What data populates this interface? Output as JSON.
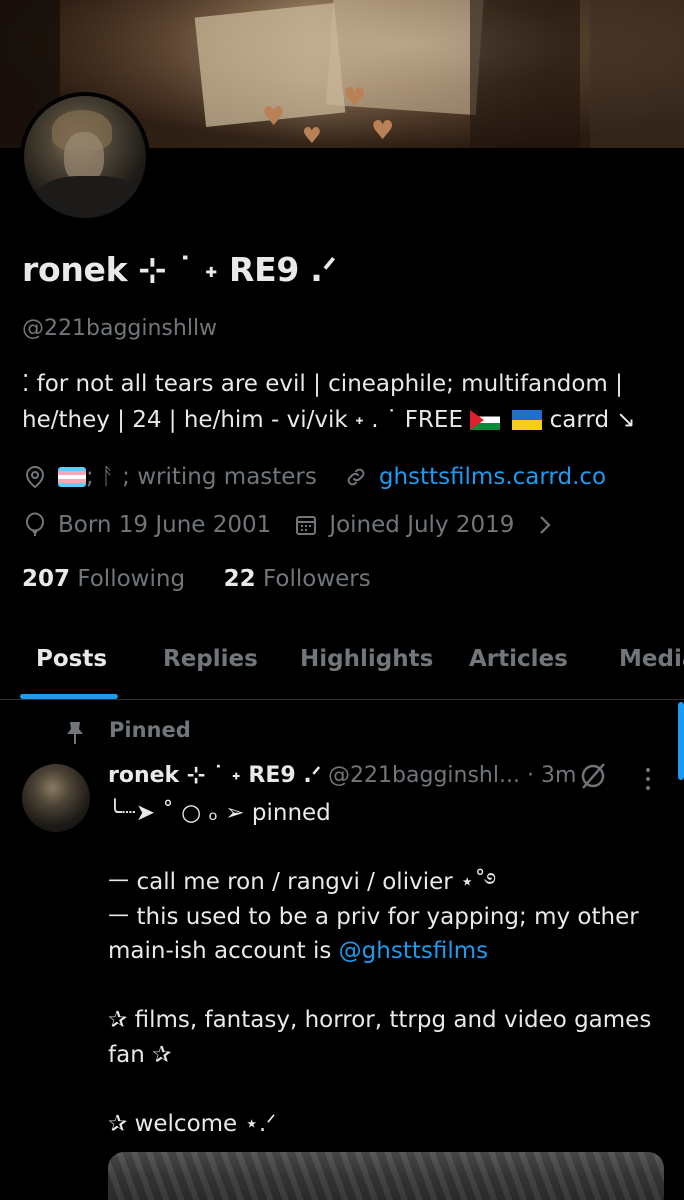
{
  "profile": {
    "display_name": "ronek ⊹ ˙ ˖ RE9 .ᐟ",
    "handle": "@221bagginshllw",
    "bio_line1": "⁚ for not all tears are evil | cineaphile; multifandom |",
    "bio_line2_a": "he/they | 24 | he/him - vi/vik ˖ . ˙ FREE ",
    "bio_line2_b": " carrd ↘",
    "location": " ; ᚨ ; writing masters",
    "website": "ghsttsfilms.carrd.co",
    "birthday": "Born 19 June 2001",
    "joined": "Joined July 2019",
    "following_count": "207",
    "following_label": "Following",
    "followers_count": "22",
    "followers_label": "Followers"
  },
  "tabs": [
    "Posts",
    "Replies",
    "Highlights",
    "Articles",
    "Media"
  ],
  "post": {
    "pinned_label": "Pinned",
    "author_name": "ronek ⊹ ˙ ˖ RE9 .ᐟ",
    "author_handle": "@221bagginshl...",
    "time": "· 3m",
    "line1": "╰┈➤ ˚ ○ ₒ ➢  pinned",
    "line2": "ㅡ call me ron / rangvi / olivier ⋆˚࿔",
    "line3": "ㅡ this used to be a priv for yapping; my other",
    "line4_a": "main-ish account is ",
    "line4_mention": "@ghsttsfilms",
    "line5": "✰ films, fantasy, horror, ttrpg and video games",
    "line6": "fan ✰",
    "line7": "✰ welcome ⋆.ᐟ"
  },
  "icons": {
    "location": "location-pin-icon",
    "link": "link-icon",
    "birthday": "balloon-icon",
    "calendar": "calendar-icon",
    "chevron": "chevron-right-icon",
    "pin": "pin-icon",
    "grok": "grok-icon",
    "more": "more-vertical-icon"
  },
  "colors": {
    "accent": "#1d9bf0",
    "muted": "#71767b",
    "text": "#e7e9ea",
    "background": "#000000"
  }
}
